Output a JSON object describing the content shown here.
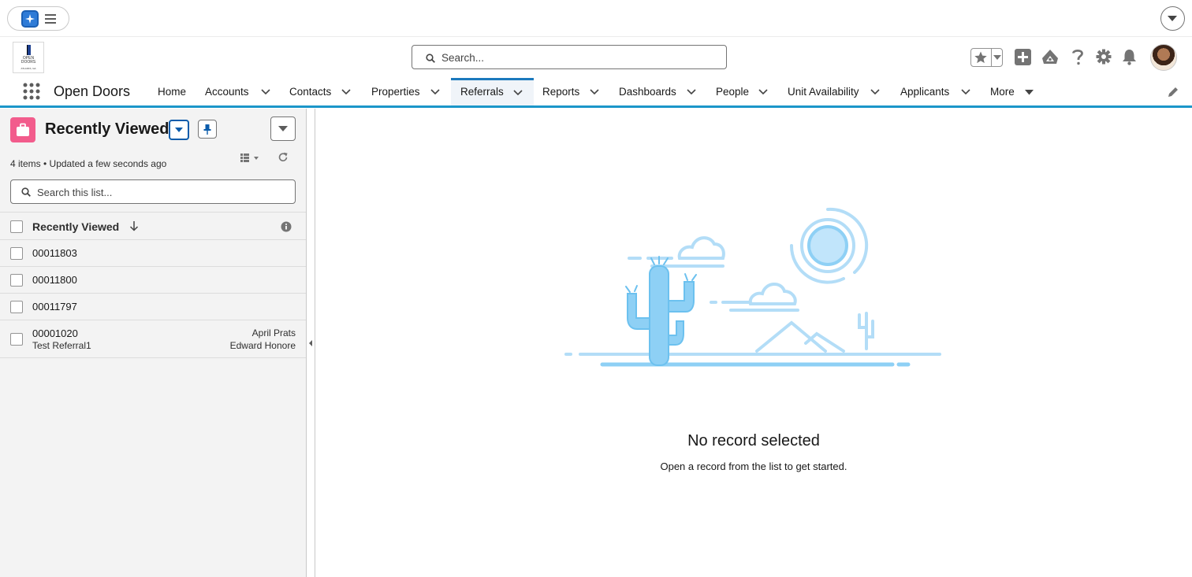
{
  "top": {
    "agent_icon": "sparkle-icon",
    "menu_icon": "hamburger-menu-icon",
    "dropdown_icon": "chevron-down-icon"
  },
  "header": {
    "logo": {
      "line1": "OPEN",
      "line2": "DOORS",
      "line3": "ATLANTA, GA"
    },
    "search": {
      "placeholder": "Search..."
    },
    "icons": [
      "star-icon",
      "add-icon",
      "trailhead-icon",
      "help-icon",
      "gear-icon",
      "bell-icon",
      "avatar"
    ]
  },
  "nav": {
    "app_name": "Open Doors",
    "items": [
      {
        "label": "Home",
        "has_menu": false
      },
      {
        "label": "Accounts",
        "has_menu": true
      },
      {
        "label": "Contacts",
        "has_menu": true
      },
      {
        "label": "Properties",
        "has_menu": true
      },
      {
        "label": "Referrals",
        "has_menu": true,
        "active": true
      },
      {
        "label": "Reports",
        "has_menu": true
      },
      {
        "label": "Dashboards",
        "has_menu": true
      },
      {
        "label": "People",
        "has_menu": true
      },
      {
        "label": "Unit Availability",
        "has_menu": true
      },
      {
        "label": "Applicants",
        "has_menu": true
      },
      {
        "label": "More",
        "has_menu": true
      }
    ]
  },
  "list": {
    "title": "Recently Viewed",
    "meta": "4 items • Updated a few seconds ago",
    "search_placeholder": "Search this list...",
    "column_header": "Recently Viewed",
    "rows": [
      {
        "name": "00011803"
      },
      {
        "name": "00011800"
      },
      {
        "name": "00011797"
      },
      {
        "name": "00001020",
        "sub": "Test Referral1",
        "right1": "April Prats",
        "right2": "Edward Honore"
      }
    ]
  },
  "main": {
    "empty_title": "No record selected",
    "empty_sub": "Open a record from the list to get started."
  },
  "colors": {
    "accent": "#1b96c9",
    "active_tab": "#1b79bd",
    "object_icon": "#f25c8c",
    "illustration": "#8ed0f5"
  }
}
